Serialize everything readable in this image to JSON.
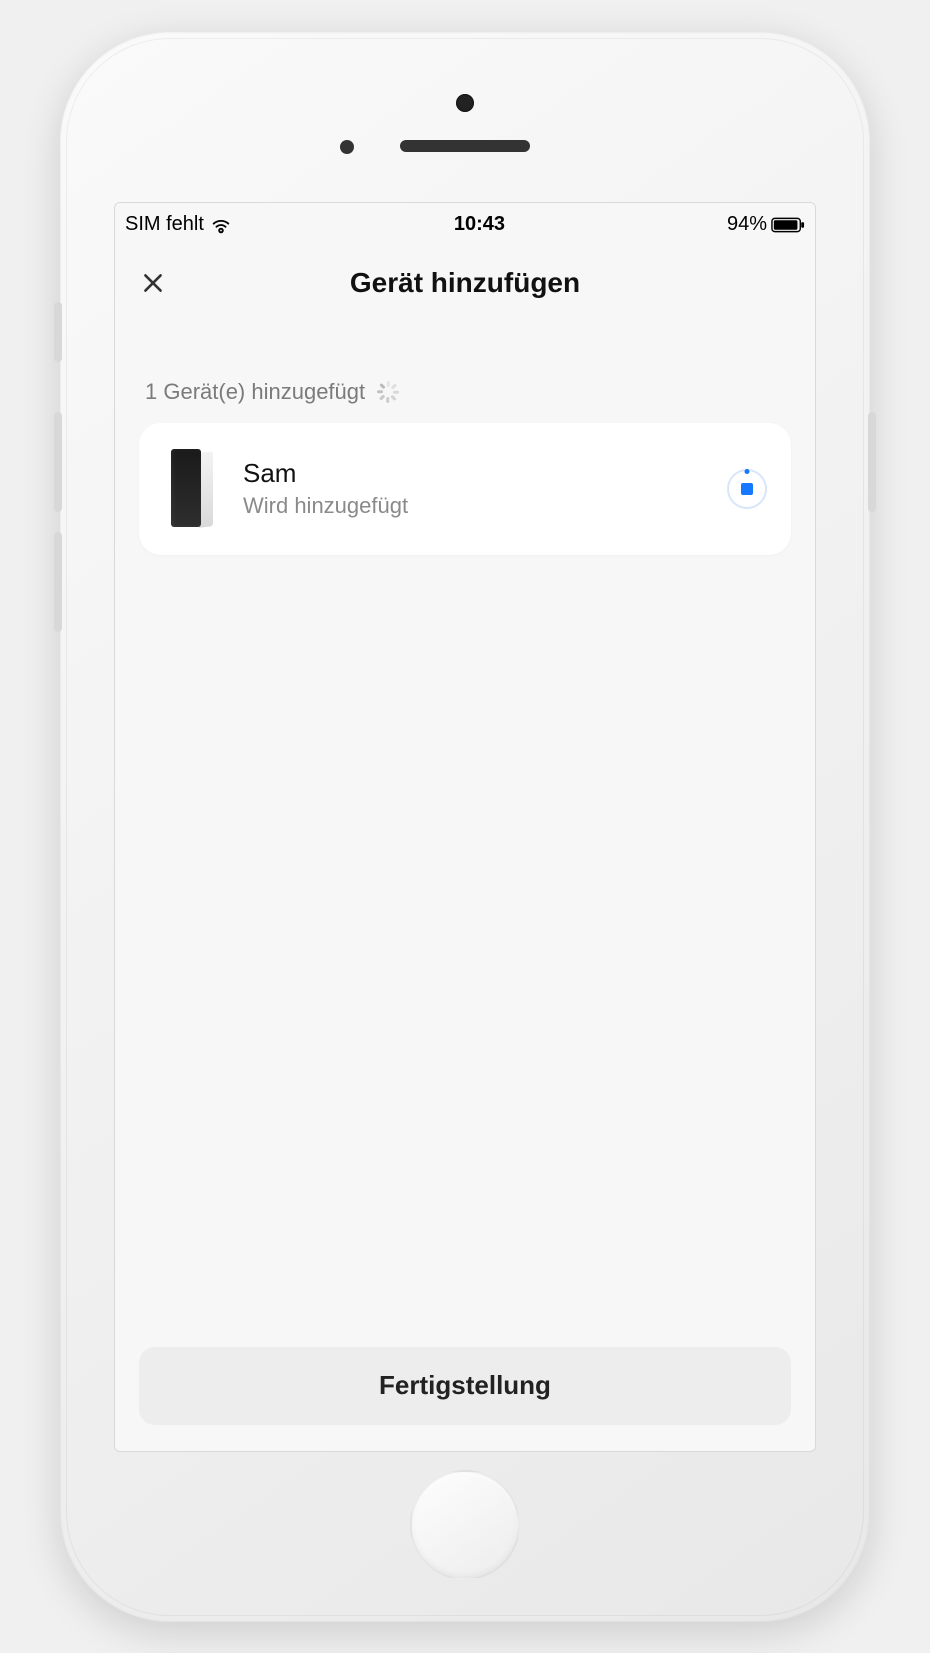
{
  "statusbar": {
    "sim_text": "SIM fehlt",
    "time": "10:43",
    "battery_pct": "94%"
  },
  "header": {
    "title": "Gerät hinzufügen"
  },
  "body": {
    "added_count_text": "1 Gerät(e) hinzugefügt"
  },
  "device": {
    "name": "Sam",
    "status": "Wird hinzugefügt"
  },
  "footer": {
    "finish_label": "Fertigstellung"
  }
}
